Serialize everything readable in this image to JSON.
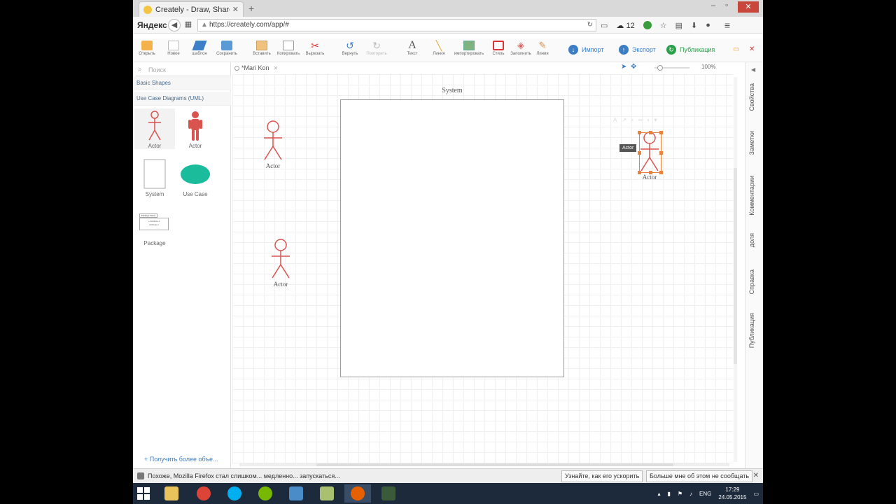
{
  "browser": {
    "tab_title": "Creately - Draw, Share, V...",
    "tab_close": "✕",
    "new_tab": "+",
    "window_buttons": [
      "–",
      "▫",
      "✕"
    ],
    "brand": "Яндекс",
    "url": "https://creately.com/app/#",
    "weather": "12"
  },
  "toolbar": {
    "tools": [
      {
        "label": "Открыть",
        "icon": "folder-icon"
      },
      {
        "label": "Новое",
        "icon": "new-document-icon"
      },
      {
        "label": "шаблон",
        "icon": "layers-icon"
      },
      {
        "label": "Сохранить",
        "icon": "save-icon"
      },
      {
        "label": "Вставить",
        "icon": "paste-icon"
      },
      {
        "label": "Копировать",
        "icon": "copy-icon"
      },
      {
        "label": "Вырезать",
        "icon": "scissors-icon"
      },
      {
        "label": "Вернуть",
        "icon": "undo-icon"
      },
      {
        "label": "Повторить",
        "icon": "redo-icon"
      },
      {
        "label": "Текст",
        "icon": "text-icon"
      },
      {
        "label": "Линия",
        "icon": "line-icon"
      },
      {
        "label": "импортировать",
        "icon": "image-icon"
      },
      {
        "label": "Стиль",
        "icon": "style-icon"
      },
      {
        "label": "Заполнить",
        "icon": "fill-icon"
      },
      {
        "label": "Линия",
        "icon": "pen-icon"
      }
    ],
    "import_label": "Импорт",
    "export_label": "Экспорт",
    "publish_label": "Публикация"
  },
  "left_panel": {
    "search_placeholder": "Поиск",
    "section_basic": "Basic Shapes",
    "section_usecase": "Use Case Diagrams (UML)",
    "shapes": [
      {
        "label": "Actor"
      },
      {
        "label": "Actor"
      },
      {
        "label": "System"
      },
      {
        "label": "Use Case"
      },
      {
        "label": "Package"
      }
    ],
    "package_header": "Package Name",
    "package_line1": "+ Attribute 1",
    "package_line2": "Attribute 2",
    "more_link": "+ Получить более объе..."
  },
  "canvas": {
    "doc_tab": "*Mari Kon",
    "doc_tab_close": "✕",
    "zoom": "100%",
    "system_label": "System",
    "actors": [
      {
        "label": "Actor"
      },
      {
        "label": "Actor"
      },
      {
        "label": "Actor"
      }
    ],
    "tooltip": "Actor"
  },
  "right_sidebar": {
    "collapse": "◀",
    "items": [
      "Свойства",
      "Заметки",
      "Комментарии",
      "доля",
      "Справка",
      "Публикация"
    ]
  },
  "notification": {
    "text": "Похоже, Mozilla Firefox стал слишком... медленно... запускаться...",
    "button1": "Узнайте, как его ускорить",
    "button2": "Больше мне об этом не сообщать",
    "close": "✕"
  },
  "taskbar": {
    "lang": "ENG",
    "time": "17:29",
    "date": "24.05.2015"
  },
  "colors": {
    "actor_stroke": "#d9534f",
    "usecase_fill": "#1abc9c",
    "selection": "#e8823c",
    "accent_blue": "#3c7dc4",
    "publish_green": "#2aa04a"
  }
}
